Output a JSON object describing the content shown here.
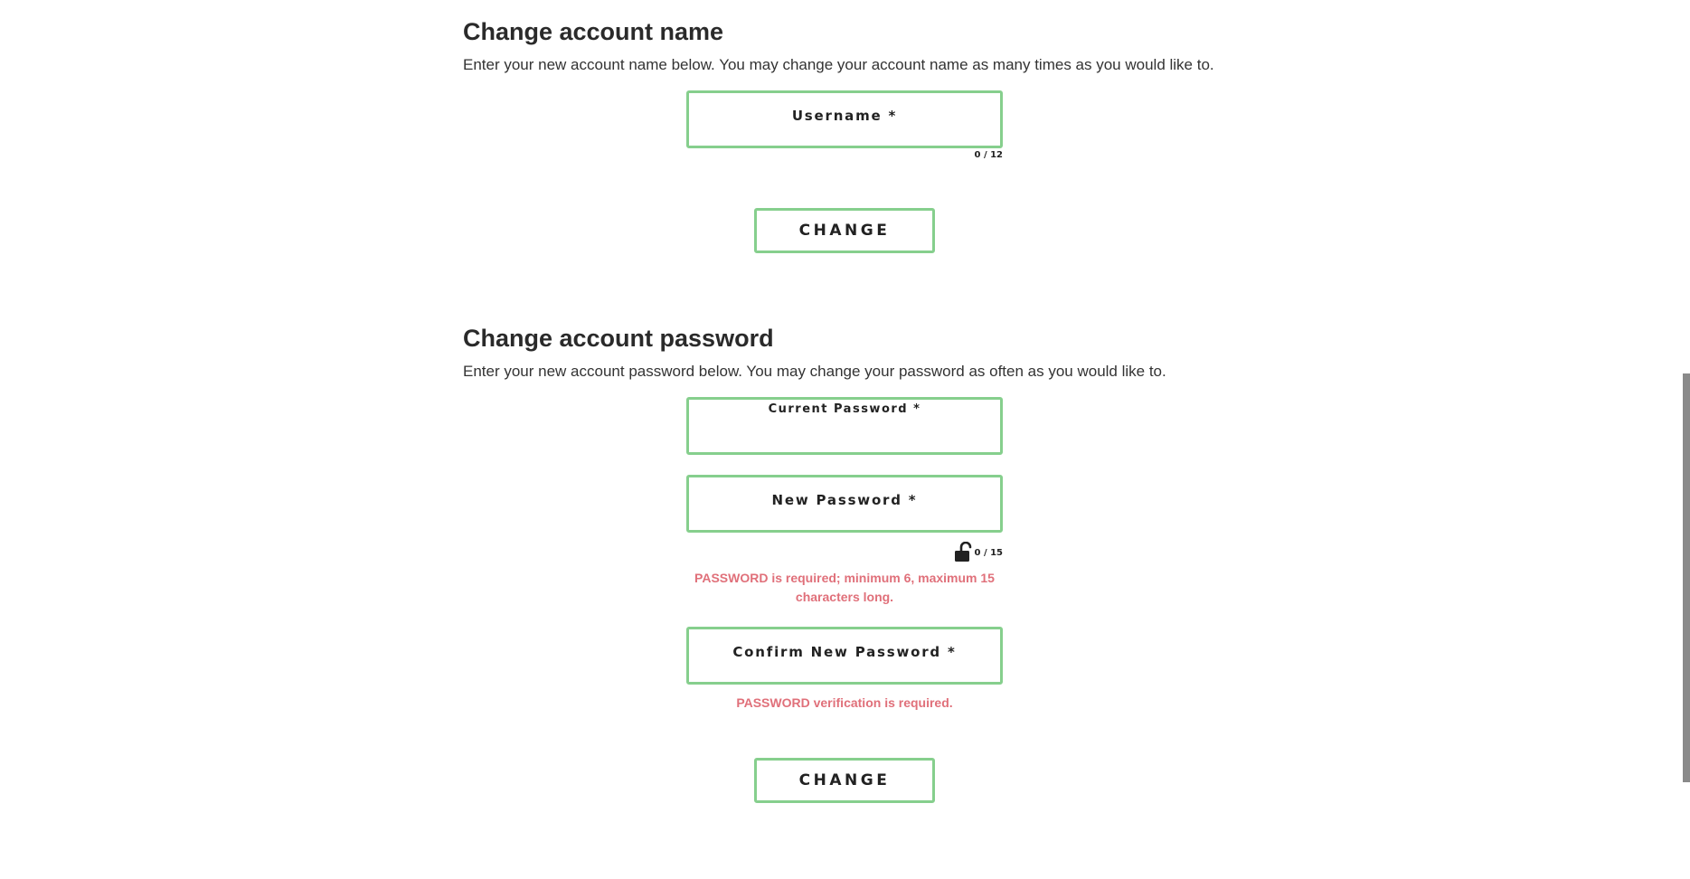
{
  "account_name": {
    "title": "Change account name",
    "description": "Enter your new account name below. You may change your account name as many times as you would like to.",
    "username": {
      "label": "Username *",
      "value": "",
      "counter": "0 / 12"
    },
    "button_label": "CHANGE"
  },
  "account_password": {
    "title": "Change account password",
    "description": "Enter your new account password below. You may change your password as often as you would like to.",
    "current_password": {
      "label": "Current Password *",
      "value": ""
    },
    "new_password": {
      "label": "New Password *",
      "value": "",
      "counter": "0 / 15",
      "visibility_icon": "unlocked-padlock-icon",
      "error": "PASSWORD is required; minimum 6, maximum 15 characters long."
    },
    "confirm_password": {
      "label": "Confirm New Password *",
      "value": "",
      "error": "PASSWORD verification is required."
    },
    "button_label": "CHANGE"
  },
  "colors": {
    "field_border": "#86cf8d",
    "error_text": "#e0707a",
    "scrollbar": "#8a8a8a"
  }
}
